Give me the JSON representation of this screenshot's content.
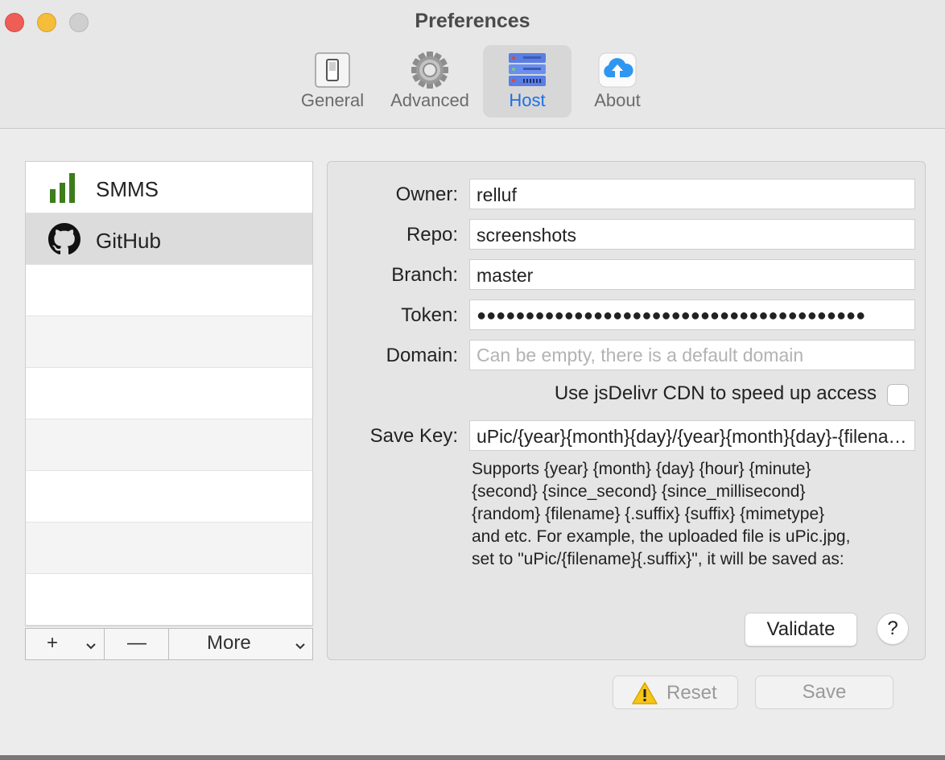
{
  "window": {
    "title": "Preferences"
  },
  "tabs": [
    {
      "label": "General",
      "icon": "switch-icon",
      "selected": false
    },
    {
      "label": "Advanced",
      "icon": "gear-icon",
      "selected": false
    },
    {
      "label": "Host",
      "icon": "server-icon",
      "selected": true
    },
    {
      "label": "About",
      "icon": "cloud-upload-icon",
      "selected": false
    }
  ],
  "hosts": [
    {
      "label": "SMMS",
      "icon": "bar-chart-icon",
      "selected": false
    },
    {
      "label": "GitHub",
      "icon": "github-icon",
      "selected": true
    }
  ],
  "list_toolbar": {
    "add": "+",
    "remove": "—",
    "more": "More"
  },
  "form": {
    "owner": {
      "label": "Owner:",
      "value": "relluf"
    },
    "repo": {
      "label": "Repo:",
      "value": "screenshots"
    },
    "branch": {
      "label": "Branch:",
      "value": "master"
    },
    "token": {
      "label": "Token:",
      "value": "●●●●●●●●●●●●●●●●●●●●●●●●●●●●●●●●●●●●●●●●"
    },
    "domain": {
      "label": "Domain:",
      "value": "",
      "placeholder": "Can be empty, there is a default domain"
    },
    "cdn": {
      "label": "Use jsDelivr CDN to speed up access",
      "checked": false
    },
    "save_key": {
      "label": "Save Key:",
      "value": "uPic/{year}{month}{day}/{year}{month}{day}-{filename}{.suffix}"
    },
    "help_lines": [
      "Supports {year} {month} {day} {hour} {minute}",
      "{second} {since_second} {since_millisecond}",
      "{random} {filename} {.suffix} {suffix} {mimetype}",
      "and etc. For example, the uploaded file is uPic.jpg,",
      "set to \"uPic/{filename}{.suffix}\", it will be saved as:"
    ],
    "validate": "Validate",
    "help": "?"
  },
  "footer": {
    "reset": "Reset",
    "save": "Save"
  },
  "colors": {
    "accent": "#1f6fe5",
    "close": "#ee5e56",
    "minimize": "#f4bd3a",
    "maximize": "#cfcfcf",
    "smms_green": "#3d7d1c"
  }
}
